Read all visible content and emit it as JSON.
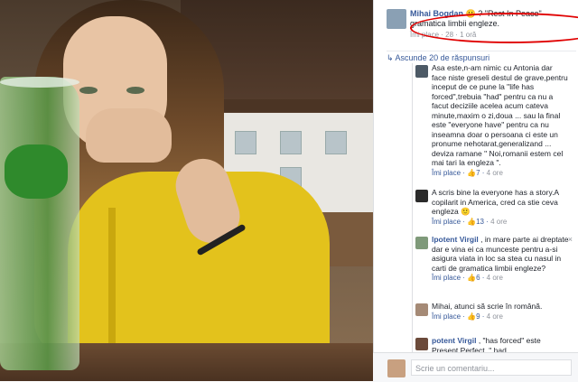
{
  "post": {
    "author": "Mihai Bogdan",
    "text_after": "? \"Rest In Peace\" gramatica limbii engleze.",
    "meta": "Îmi place · 28 · 1 oră"
  },
  "replies_label": "Ascunde 20 de răspunsuri",
  "comments": [
    {
      "name": "",
      "text": "Asa este,n-am nimic cu Antonia dar face niste greseli destul de grave,pentru inceput de ce pune la \"life has forced\",trebuia \"had\" pentru ca nu a facut deciziile acelea acum cateva minute,maxim o zi,doua ... sau la final este \"everyone have\" pentru ca nu inseamna doar o persoana ci este un pronume nehotarat,generalizand ... deviza ramane \" Noi,romanii estem cel mai tari la engleza \".",
      "like": "Îmi place",
      "count": "7",
      "time": "4 ore"
    },
    {
      "name": "",
      "text": "A scris bine la everyone has a story.A copilarit in America, cred ca stie ceva engleza 🙂",
      "like": "Îmi place",
      "count": "13",
      "time": "4 ore"
    },
    {
      "name": "lpotent Virgil",
      "text": ", in mare parte ai dreptate dar e vina ei ca munceste pentru a-si asigura viata in loc sa stea cu nasul in carti de gramatica limbii engleze?",
      "like": "Îmi place",
      "count": "6",
      "time": "4 ore"
    },
    {
      "name": "",
      "text": "Mihai, atunci să scrie în română.",
      "like": "Îmi place",
      "count": "9",
      "time": "4 ore"
    },
    {
      "name": "potent Virgil",
      "text": ", \"has forced\" este Present Perfect. \" had",
      "like": "",
      "count": "",
      "time": ""
    }
  ],
  "close_symbol": "×",
  "input_placeholder": "Scrie un comentariu..."
}
